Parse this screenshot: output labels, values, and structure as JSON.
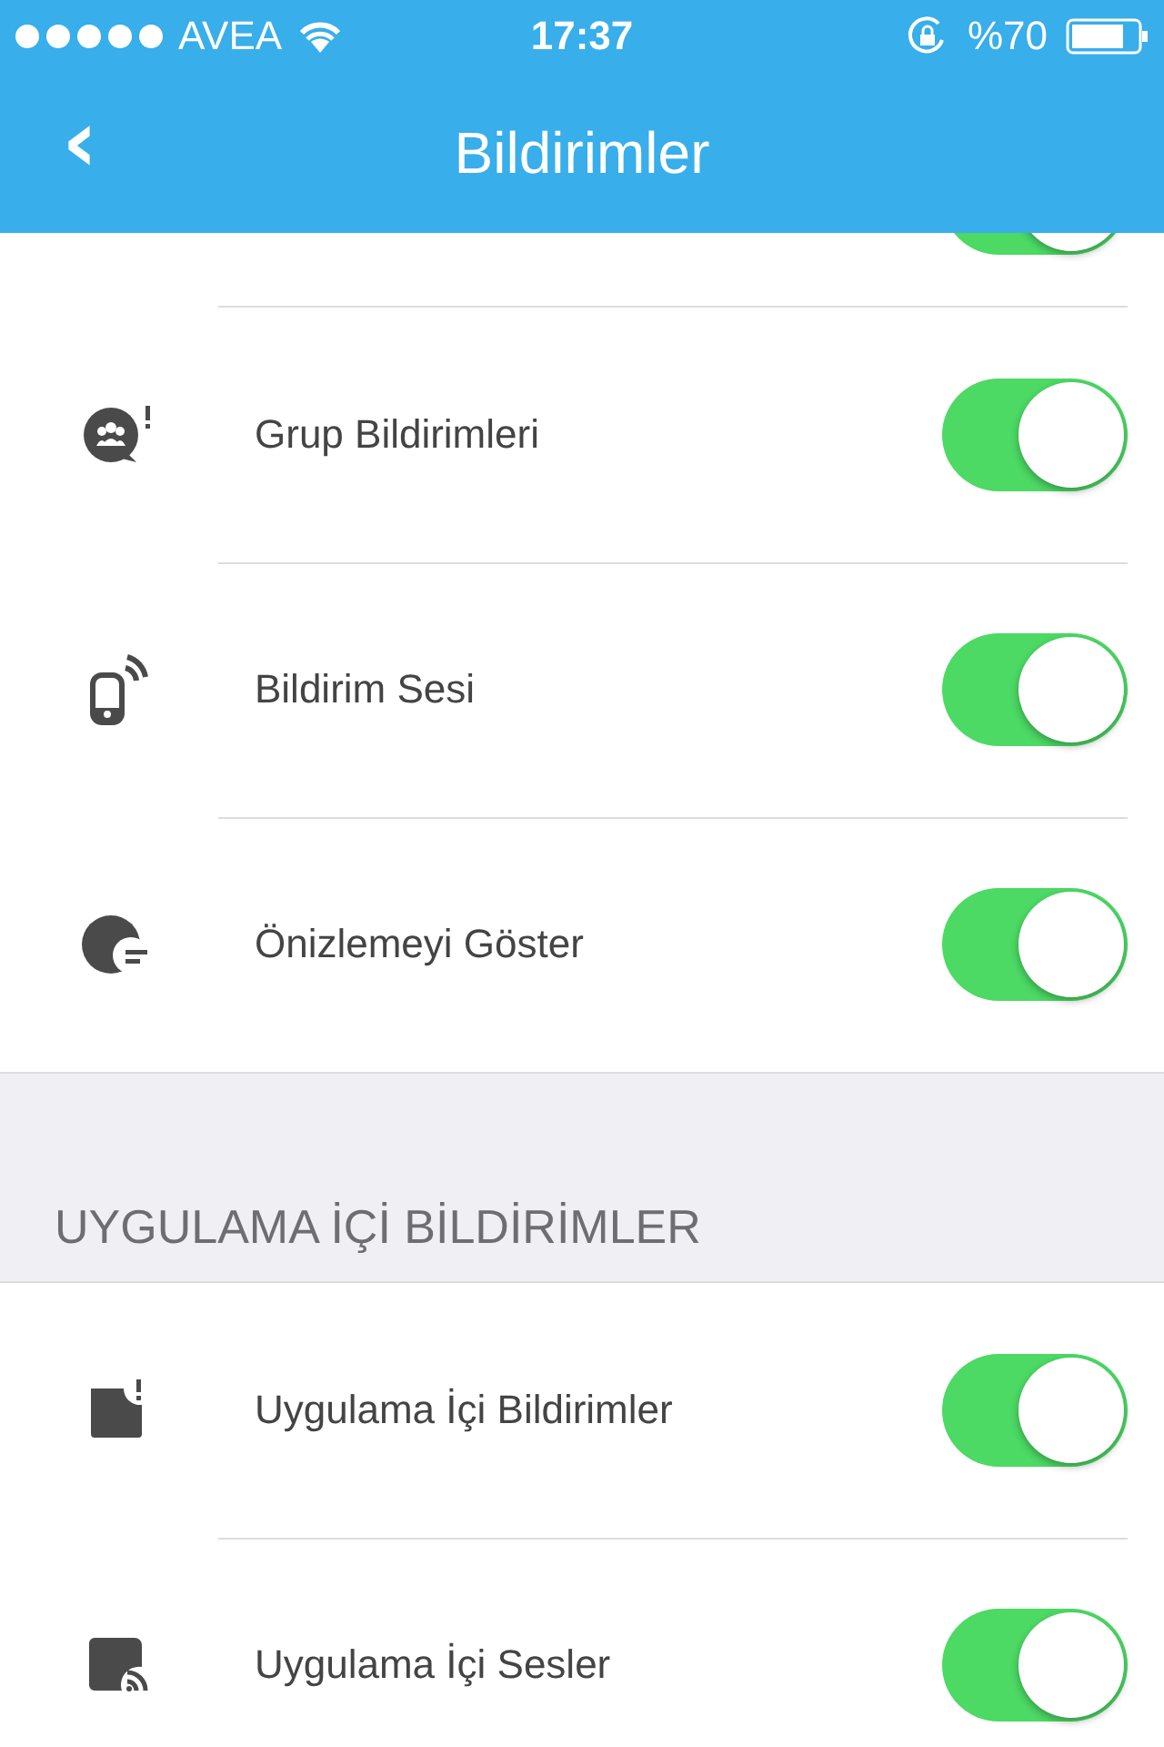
{
  "status_bar": {
    "carrier": "AVEA",
    "time": "17:37",
    "battery": "%70"
  },
  "nav": {
    "back": "‹",
    "title": "Bildirimler"
  },
  "partial_toggle": {
    "on": true
  },
  "sections": [
    {
      "items": [
        {
          "kind": "group",
          "label": "Grup Bildirimleri",
          "on": true
        },
        {
          "kind": "sound",
          "label": "Bildirim Sesi",
          "on": true
        },
        {
          "kind": "preview",
          "label": "Önizlemeyi Göster",
          "on": true
        }
      ]
    },
    {
      "header": "UYGULAMA İÇİ BİLDİRİMLER",
      "items": [
        {
          "kind": "inapp",
          "label": "Uygulama İçi Bildirimler",
          "on": true
        },
        {
          "kind": "inappsound",
          "label": "Uygulama İçi Sesler",
          "on": true
        }
      ]
    }
  ]
}
